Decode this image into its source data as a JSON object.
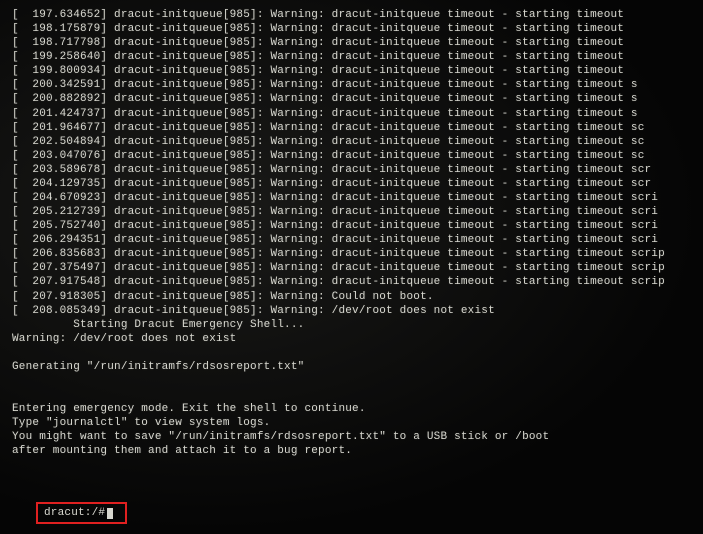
{
  "logLines": [
    "[  197.634652] dracut-initqueue[985]: Warning: dracut-initqueue timeout - starting timeout",
    "[  198.175879] dracut-initqueue[985]: Warning: dracut-initqueue timeout - starting timeout",
    "[  198.717798] dracut-initqueue[985]: Warning: dracut-initqueue timeout - starting timeout",
    "[  199.258640] dracut-initqueue[985]: Warning: dracut-initqueue timeout - starting timeout",
    "[  199.800934] dracut-initqueue[985]: Warning: dracut-initqueue timeout - starting timeout",
    "[  200.342591] dracut-initqueue[985]: Warning: dracut-initqueue timeout - starting timeout s",
    "[  200.882892] dracut-initqueue[985]: Warning: dracut-initqueue timeout - starting timeout s",
    "[  201.424737] dracut-initqueue[985]: Warning: dracut-initqueue timeout - starting timeout s",
    "[  201.964677] dracut-initqueue[985]: Warning: dracut-initqueue timeout - starting timeout sc",
    "[  202.504894] dracut-initqueue[985]: Warning: dracut-initqueue timeout - starting timeout sc",
    "[  203.047076] dracut-initqueue[985]: Warning: dracut-initqueue timeout - starting timeout sc",
    "[  203.589678] dracut-initqueue[985]: Warning: dracut-initqueue timeout - starting timeout scr",
    "[  204.129735] dracut-initqueue[985]: Warning: dracut-initqueue timeout - starting timeout scr",
    "[  204.670923] dracut-initqueue[985]: Warning: dracut-initqueue timeout - starting timeout scri",
    "[  205.212739] dracut-initqueue[985]: Warning: dracut-initqueue timeout - starting timeout scri",
    "[  205.752740] dracut-initqueue[985]: Warning: dracut-initqueue timeout - starting timeout scri",
    "[  206.294351] dracut-initqueue[985]: Warning: dracut-initqueue timeout - starting timeout scri",
    "[  206.835683] dracut-initqueue[985]: Warning: dracut-initqueue timeout - starting timeout scrip",
    "[  207.375497] dracut-initqueue[985]: Warning: dracut-initqueue timeout - starting timeout scrip",
    "[  207.917548] dracut-initqueue[985]: Warning: dracut-initqueue timeout - starting timeout scrip",
    "[  207.918305] dracut-initqueue[985]: Warning: Could not boot.",
    "[  208.085349] dracut-initqueue[985]: Warning: /dev/root does not exist",
    "         Starting Dracut Emergency Shell...",
    "Warning: /dev/root does not exist",
    "",
    "Generating \"/run/initramfs/rdsosreport.txt\"",
    "",
    "",
    "Entering emergency mode. Exit the shell to continue.",
    "Type \"journalctl\" to view system logs.",
    "You might want to save \"/run/initramfs/rdsosreport.txt\" to a USB stick or /boot",
    "after mounting them and attach it to a bug report.",
    "",
    ""
  ],
  "prompt": "dracut:/#"
}
